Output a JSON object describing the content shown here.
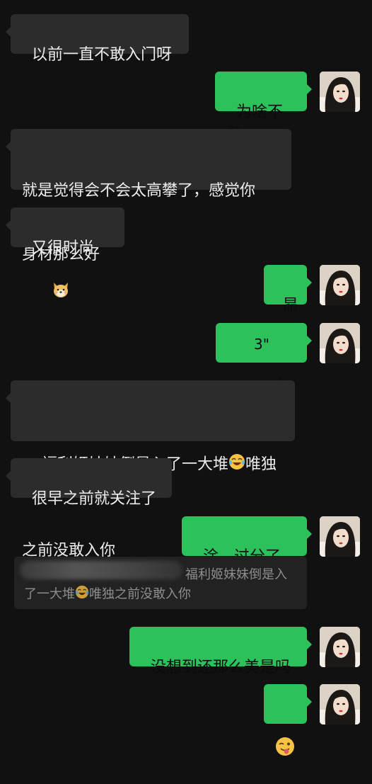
{
  "messages": {
    "m1": {
      "text": "以前一直不敢入门呀"
    },
    "m2": {
      "text": "为啥不敢"
    },
    "m3": {
      "line1": "就是觉得会不会太高攀了，感觉你",
      "line2": "身材那么好"
    },
    "m4": {
      "text": "又很时尚",
      "emoji": "dog-face-emoji"
    },
    "m5": {
      "text": "昂"
    },
    "m6": {
      "duration": "3\"",
      "icon": "voice-wave-icon"
    },
    "m7": {
      "line1_a": "福利姬妹妹倒是入了一大堆",
      "line1_b": "唯独",
      "line2": "之前没敢入你",
      "emoji": "laughing-tears-emoji"
    },
    "m8": {
      "text": "很早之前就关注了"
    },
    "m9": {
      "text": "淦、过分了啊"
    },
    "m10": {
      "text": "没想到还那么美是吗"
    },
    "m11": {
      "emoji": "winking-tongue-emoji"
    }
  },
  "quote": {
    "line1": "福利姬妹妹倒是入",
    "line2_a": "了一大堆",
    "line2_b": "唯独之前没敢入你",
    "emoji": "laughing-tears-emoji"
  },
  "colors": {
    "background": "#111111",
    "incoming_bubble": "#2c2c2c",
    "outgoing_bubble": "#2dc15c",
    "quote_bg": "#222222"
  }
}
